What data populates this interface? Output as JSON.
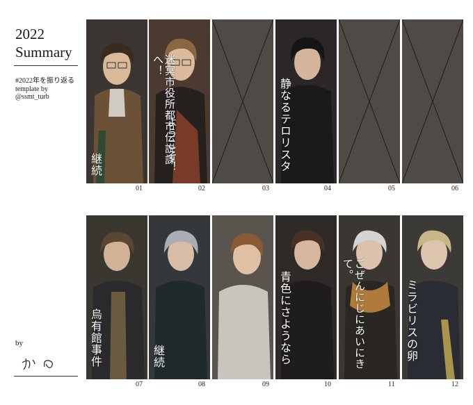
{
  "heading": {
    "line1": "2022",
    "line2": "Summary"
  },
  "hashtag": "#2022年を振り返る",
  "template_credit": {
    "line1": "template by",
    "line2": "@ssmt_turb"
  },
  "by_label": "by",
  "signature": "かの",
  "colors": {
    "empty_panel": "#4f4a45",
    "empty_cross": "#1e1c1a",
    "caption": "#ffffff"
  },
  "panels": [
    {
      "number": "01",
      "caption": "継続",
      "empty": false
    },
    {
      "number": "02",
      "caption": "迷冥市役所都市伝説課へ！",
      "caption2": "ようこそ！",
      "empty": false
    },
    {
      "number": "03",
      "caption": "",
      "empty": true
    },
    {
      "number": "04",
      "caption": "静なるテロリスタ",
      "empty": false
    },
    {
      "number": "05",
      "caption": "",
      "empty": true
    },
    {
      "number": "06",
      "caption": "",
      "empty": true
    },
    {
      "number": "07",
      "caption": "烏有館事件",
      "empty": false
    },
    {
      "number": "08",
      "caption": "継続",
      "empty": false
    },
    {
      "number": "09",
      "caption": "",
      "empty": false
    },
    {
      "number": "10",
      "caption": "青色にさようなら",
      "empty": false
    },
    {
      "number": "11",
      "caption": "ごぜんにじにあいにきて。",
      "empty": false
    },
    {
      "number": "12",
      "caption": "ミラビリスの卵",
      "empty": false
    }
  ]
}
